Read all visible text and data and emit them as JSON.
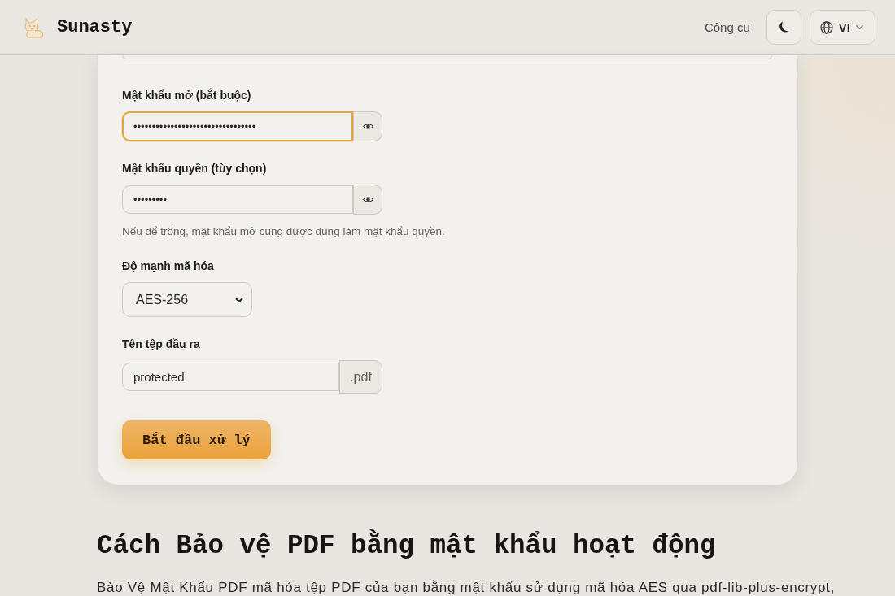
{
  "header": {
    "brand": "Sunasty",
    "nav": [
      {
        "label": "Công cụ"
      }
    ],
    "language": "VI"
  },
  "form": {
    "fields": [
      {
        "kind": "password",
        "label": "Mật khẩu mở (bắt buộc)",
        "value": "•••••••••••••••••••••••••••••••••",
        "focused": true
      },
      {
        "kind": "password",
        "label": "Mật khẩu quyền (tùy chọn)",
        "value": "•••••••••",
        "focused": false,
        "hint": "Nếu để trống, mật khẩu mở cũng được dùng làm mật khẩu quyền."
      },
      {
        "kind": "select",
        "label": "Độ mạnh mã hóa",
        "value": "AES-256"
      },
      {
        "kind": "filename",
        "label": "Tên tệp đầu ra",
        "value": "protected",
        "suffix": ".pdf"
      }
    ],
    "submit": "Bắt đầu xử lý"
  },
  "section": {
    "heading": "Cách Bảo vệ PDF bằng mật khẩu hoạt động",
    "paragraph": "Bảo Vệ Mật Khẩu PDF mã hóa tệp PDF của bạn bằng mật khẩu sử dụng mã hóa AES qua pdf-lib-plus-encrypt,"
  }
}
